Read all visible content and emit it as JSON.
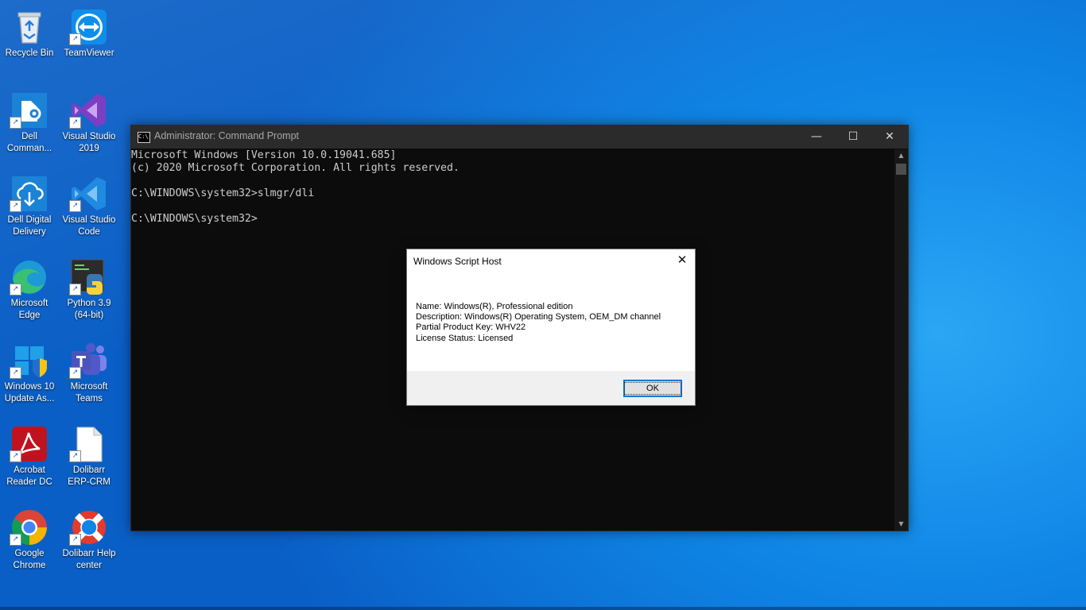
{
  "desktop_icons": [
    {
      "label": "Recycle Bin",
      "icon": "recycle-bin-icon"
    },
    {
      "label": "TeamViewer",
      "icon": "teamviewer-icon"
    },
    {
      "label": "Dell\nComman...",
      "icon": "dell-command-icon"
    },
    {
      "label": "Visual Studio\n2019",
      "icon": "visual-studio-icon"
    },
    {
      "label": "Dell Digital\nDelivery",
      "icon": "dell-digital-delivery-icon"
    },
    {
      "label": "Visual Studio\nCode",
      "icon": "vscode-icon"
    },
    {
      "label": "Microsoft\nEdge",
      "icon": "edge-icon"
    },
    {
      "label": "Python 3.9\n(64-bit)",
      "icon": "python-icon"
    },
    {
      "label": "Windows 10\nUpdate As...",
      "icon": "windows-update-assistant-icon"
    },
    {
      "label": "Microsoft\nTeams",
      "icon": "teams-icon"
    },
    {
      "label": "Acrobat\nReader DC",
      "icon": "acrobat-icon"
    },
    {
      "label": "Dolibarr\nERP-CRM",
      "icon": "file-icon"
    },
    {
      "label": "Google\nChrome",
      "icon": "chrome-icon"
    },
    {
      "label": "Dolibarr Help\ncenter",
      "icon": "lifebuoy-icon"
    }
  ],
  "cmd_window": {
    "title": "Administrator: Command Prompt",
    "minimize_glyph": "—",
    "maximize_glyph": "☐",
    "close_glyph": "✕",
    "lines": [
      "Microsoft Windows [Version 10.0.19041.685]",
      "(c) 2020 Microsoft Corporation. All rights reserved.",
      "",
      "C:\\WINDOWS\\system32>slmgr/dli",
      "",
      "C:\\WINDOWS\\system32>"
    ]
  },
  "message_box": {
    "title": "Windows Script Host",
    "close_glyph": "✕",
    "lines": [
      "Name: Windows(R), Professional edition",
      "Description: Windows(R) Operating System, OEM_DM channel",
      "Partial Product Key: WHV22",
      "License Status: Licensed"
    ],
    "ok_label": "OK"
  },
  "colors": {
    "console_bg": "#0c0c0c",
    "console_text": "#cccccc",
    "accent": "#0078d7"
  }
}
